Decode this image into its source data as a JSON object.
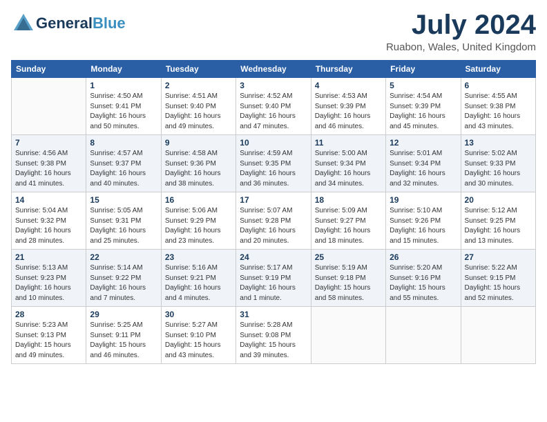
{
  "header": {
    "logo_line1": "General",
    "logo_line2": "Blue",
    "month_title": "July 2024",
    "location": "Ruabon, Wales, United Kingdom"
  },
  "weekdays": [
    "Sunday",
    "Monday",
    "Tuesday",
    "Wednesday",
    "Thursday",
    "Friday",
    "Saturday"
  ],
  "weeks": [
    [
      {
        "day": "",
        "sunrise": "",
        "sunset": "",
        "daylight": ""
      },
      {
        "day": "1",
        "sunrise": "Sunrise: 4:50 AM",
        "sunset": "Sunset: 9:41 PM",
        "daylight": "Daylight: 16 hours and 50 minutes."
      },
      {
        "day": "2",
        "sunrise": "Sunrise: 4:51 AM",
        "sunset": "Sunset: 9:40 PM",
        "daylight": "Daylight: 16 hours and 49 minutes."
      },
      {
        "day": "3",
        "sunrise": "Sunrise: 4:52 AM",
        "sunset": "Sunset: 9:40 PM",
        "daylight": "Daylight: 16 hours and 47 minutes."
      },
      {
        "day": "4",
        "sunrise": "Sunrise: 4:53 AM",
        "sunset": "Sunset: 9:39 PM",
        "daylight": "Daylight: 16 hours and 46 minutes."
      },
      {
        "day": "5",
        "sunrise": "Sunrise: 4:54 AM",
        "sunset": "Sunset: 9:39 PM",
        "daylight": "Daylight: 16 hours and 45 minutes."
      },
      {
        "day": "6",
        "sunrise": "Sunrise: 4:55 AM",
        "sunset": "Sunset: 9:38 PM",
        "daylight": "Daylight: 16 hours and 43 minutes."
      }
    ],
    [
      {
        "day": "7",
        "sunrise": "Sunrise: 4:56 AM",
        "sunset": "Sunset: 9:38 PM",
        "daylight": "Daylight: 16 hours and 41 minutes."
      },
      {
        "day": "8",
        "sunrise": "Sunrise: 4:57 AM",
        "sunset": "Sunset: 9:37 PM",
        "daylight": "Daylight: 16 hours and 40 minutes."
      },
      {
        "day": "9",
        "sunrise": "Sunrise: 4:58 AM",
        "sunset": "Sunset: 9:36 PM",
        "daylight": "Daylight: 16 hours and 38 minutes."
      },
      {
        "day": "10",
        "sunrise": "Sunrise: 4:59 AM",
        "sunset": "Sunset: 9:35 PM",
        "daylight": "Daylight: 16 hours and 36 minutes."
      },
      {
        "day": "11",
        "sunrise": "Sunrise: 5:00 AM",
        "sunset": "Sunset: 9:34 PM",
        "daylight": "Daylight: 16 hours and 34 minutes."
      },
      {
        "day": "12",
        "sunrise": "Sunrise: 5:01 AM",
        "sunset": "Sunset: 9:34 PM",
        "daylight": "Daylight: 16 hours and 32 minutes."
      },
      {
        "day": "13",
        "sunrise": "Sunrise: 5:02 AM",
        "sunset": "Sunset: 9:33 PM",
        "daylight": "Daylight: 16 hours and 30 minutes."
      }
    ],
    [
      {
        "day": "14",
        "sunrise": "Sunrise: 5:04 AM",
        "sunset": "Sunset: 9:32 PM",
        "daylight": "Daylight: 16 hours and 28 minutes."
      },
      {
        "day": "15",
        "sunrise": "Sunrise: 5:05 AM",
        "sunset": "Sunset: 9:31 PM",
        "daylight": "Daylight: 16 hours and 25 minutes."
      },
      {
        "day": "16",
        "sunrise": "Sunrise: 5:06 AM",
        "sunset": "Sunset: 9:29 PM",
        "daylight": "Daylight: 16 hours and 23 minutes."
      },
      {
        "day": "17",
        "sunrise": "Sunrise: 5:07 AM",
        "sunset": "Sunset: 9:28 PM",
        "daylight": "Daylight: 16 hours and 20 minutes."
      },
      {
        "day": "18",
        "sunrise": "Sunrise: 5:09 AM",
        "sunset": "Sunset: 9:27 PM",
        "daylight": "Daylight: 16 hours and 18 minutes."
      },
      {
        "day": "19",
        "sunrise": "Sunrise: 5:10 AM",
        "sunset": "Sunset: 9:26 PM",
        "daylight": "Daylight: 16 hours and 15 minutes."
      },
      {
        "day": "20",
        "sunrise": "Sunrise: 5:12 AM",
        "sunset": "Sunset: 9:25 PM",
        "daylight": "Daylight: 16 hours and 13 minutes."
      }
    ],
    [
      {
        "day": "21",
        "sunrise": "Sunrise: 5:13 AM",
        "sunset": "Sunset: 9:23 PM",
        "daylight": "Daylight: 16 hours and 10 minutes."
      },
      {
        "day": "22",
        "sunrise": "Sunrise: 5:14 AM",
        "sunset": "Sunset: 9:22 PM",
        "daylight": "Daylight: 16 hours and 7 minutes."
      },
      {
        "day": "23",
        "sunrise": "Sunrise: 5:16 AM",
        "sunset": "Sunset: 9:21 PM",
        "daylight": "Daylight: 16 hours and 4 minutes."
      },
      {
        "day": "24",
        "sunrise": "Sunrise: 5:17 AM",
        "sunset": "Sunset: 9:19 PM",
        "daylight": "Daylight: 16 hours and 1 minute."
      },
      {
        "day": "25",
        "sunrise": "Sunrise: 5:19 AM",
        "sunset": "Sunset: 9:18 PM",
        "daylight": "Daylight: 15 hours and 58 minutes."
      },
      {
        "day": "26",
        "sunrise": "Sunrise: 5:20 AM",
        "sunset": "Sunset: 9:16 PM",
        "daylight": "Daylight: 15 hours and 55 minutes."
      },
      {
        "day": "27",
        "sunrise": "Sunrise: 5:22 AM",
        "sunset": "Sunset: 9:15 PM",
        "daylight": "Daylight: 15 hours and 52 minutes."
      }
    ],
    [
      {
        "day": "28",
        "sunrise": "Sunrise: 5:23 AM",
        "sunset": "Sunset: 9:13 PM",
        "daylight": "Daylight: 15 hours and 49 minutes."
      },
      {
        "day": "29",
        "sunrise": "Sunrise: 5:25 AM",
        "sunset": "Sunset: 9:11 PM",
        "daylight": "Daylight: 15 hours and 46 minutes."
      },
      {
        "day": "30",
        "sunrise": "Sunrise: 5:27 AM",
        "sunset": "Sunset: 9:10 PM",
        "daylight": "Daylight: 15 hours and 43 minutes."
      },
      {
        "day": "31",
        "sunrise": "Sunrise: 5:28 AM",
        "sunset": "Sunset: 9:08 PM",
        "daylight": "Daylight: 15 hours and 39 minutes."
      },
      {
        "day": "",
        "sunrise": "",
        "sunset": "",
        "daylight": ""
      },
      {
        "day": "",
        "sunrise": "",
        "sunset": "",
        "daylight": ""
      },
      {
        "day": "",
        "sunrise": "",
        "sunset": "",
        "daylight": ""
      }
    ]
  ]
}
